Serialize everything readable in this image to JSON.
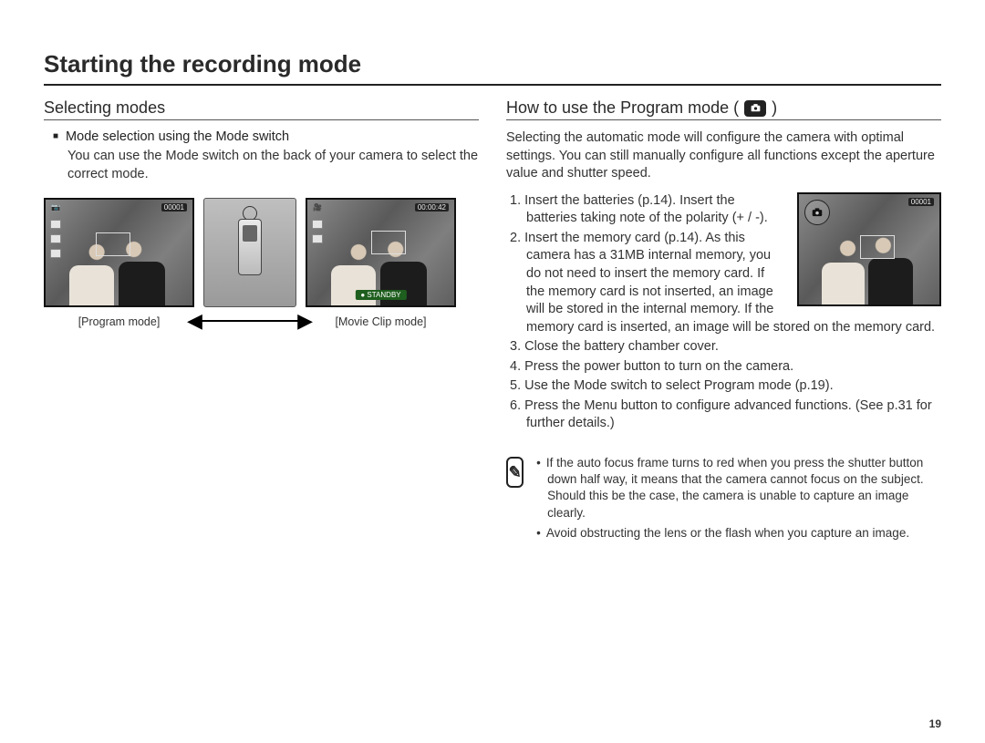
{
  "pageTitle": "Starting the recording mode",
  "pageNumber": "19",
  "left": {
    "heading": "Selecting modes",
    "subheading": "Mode selection using the Mode switch",
    "body": "You can use the Mode switch on the back of your camera to select the correct mode.",
    "caption1": "[Program mode]",
    "caption2": "[Movie Clip mode]",
    "lcd1": {
      "count": "00001",
      "topIcons": "📷"
    },
    "lcd2": {
      "timer": "00:00:42",
      "standby": "STANDBY"
    }
  },
  "right": {
    "heading": "How to use the Program mode (",
    "heading_end": ")",
    "intro": "Selecting the automatic mode will configure the camera with optimal settings. You can still manually configure all functions except the aperture value and shutter speed.",
    "steps": [
      "1. Insert the batteries (p.14). Insert the batteries taking note of the polarity (+ / -).",
      "2. Insert the memory card (p.14). As this camera has a 31MB internal memory, you do not need to insert the memory card. If the memory card is not inserted, an image will be stored in the internal memory. If the memory card is inserted, an image will be stored on the memory card.",
      "3. Close the battery chamber cover.",
      "4. Press the power button to turn on the camera.",
      "5. Use the Mode switch to select Program mode (p.19).",
      "6. Press the Menu button to configure advanced functions. (See p.31 for further details.)"
    ],
    "tips": [
      "If the auto focus frame turns to red when you press the shutter button down half way, it means that the camera cannot focus on the subject. Should this be the case, the camera is unable to capture an image clearly.",
      "Avoid obstructing the lens or the flash when you capture an image."
    ],
    "lcd": {
      "count": "00001"
    }
  }
}
